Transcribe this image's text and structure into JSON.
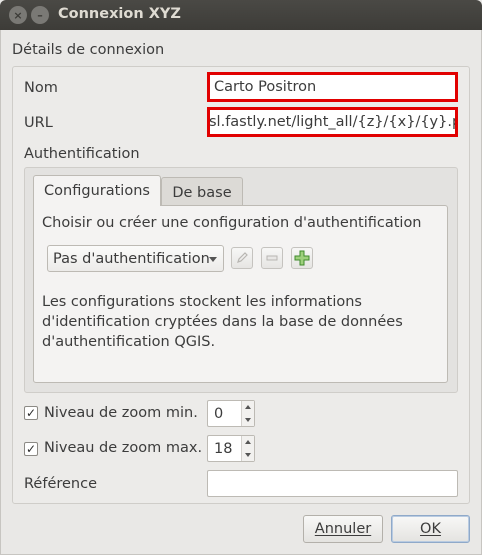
{
  "window": {
    "title": "Connexion XYZ",
    "close_glyph": "×",
    "minimize_glyph": "–"
  },
  "group": {
    "title": "Détails de connexion"
  },
  "name": {
    "label": "Nom",
    "value": "Carto Positron"
  },
  "url": {
    "label": "URL",
    "value": "sl.fastly.net/light_all/{z}/{x}/{y}.png"
  },
  "auth": {
    "title": "Authentification",
    "tabs": [
      {
        "label": "Configurations",
        "active": true
      },
      {
        "label": "De base",
        "active": false
      }
    ],
    "choose_label": "Choisir ou créer une configuration d'authentification",
    "selected_config": "Pas d'authentification",
    "description": "Les configurations stockent les informations d'identification cryptées dans la base de données d'authentification QGIS.",
    "icons": [
      "edit-icon",
      "remove-icon",
      "add-icon"
    ]
  },
  "zoom_min": {
    "label": "Niveau de zoom min.",
    "checked": true,
    "value": "0"
  },
  "zoom_max": {
    "label": "Niveau de zoom max.",
    "checked": true,
    "value": "18"
  },
  "reference": {
    "label": "Référence",
    "value": ""
  },
  "buttons": {
    "cancel": "Annuler",
    "ok": "OK"
  },
  "colors": {
    "highlight": "#e10000",
    "titlebar": "#3d3c38"
  }
}
